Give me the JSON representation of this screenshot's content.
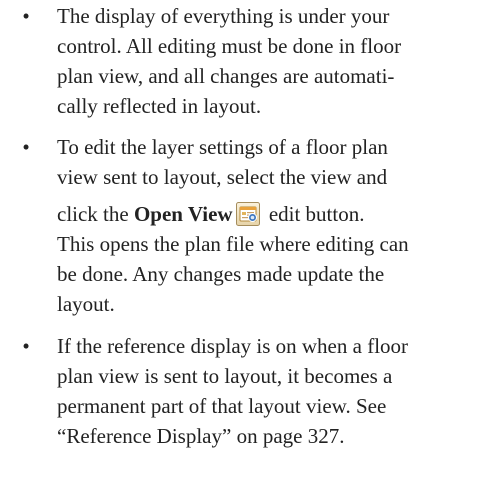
{
  "bullet_symbol": "•",
  "items": [
    {
      "lines": [
        "The display of everything is under your",
        "control. All editing must be done in floor",
        "plan view, and all changes are automati-",
        "cally reflected in layout."
      ]
    },
    {
      "lines": [
        "To edit the layer settings of a floor plan",
        "view sent to layout, select the view and"
      ],
      "click_text": "click the ",
      "bold_text": "Open View",
      "icon": "open-view-icon",
      "after_icon_text": " edit button.",
      "tail_lines": [
        "This opens the plan file where editing can",
        "be done. Any changes made update the",
        "layout."
      ]
    },
    {
      "lines": [
        "If the reference display is on when a floor",
        "plan view is sent to layout, it becomes a",
        "permanent part of that layout view. See",
        "“Reference Display” on page 327."
      ]
    }
  ]
}
